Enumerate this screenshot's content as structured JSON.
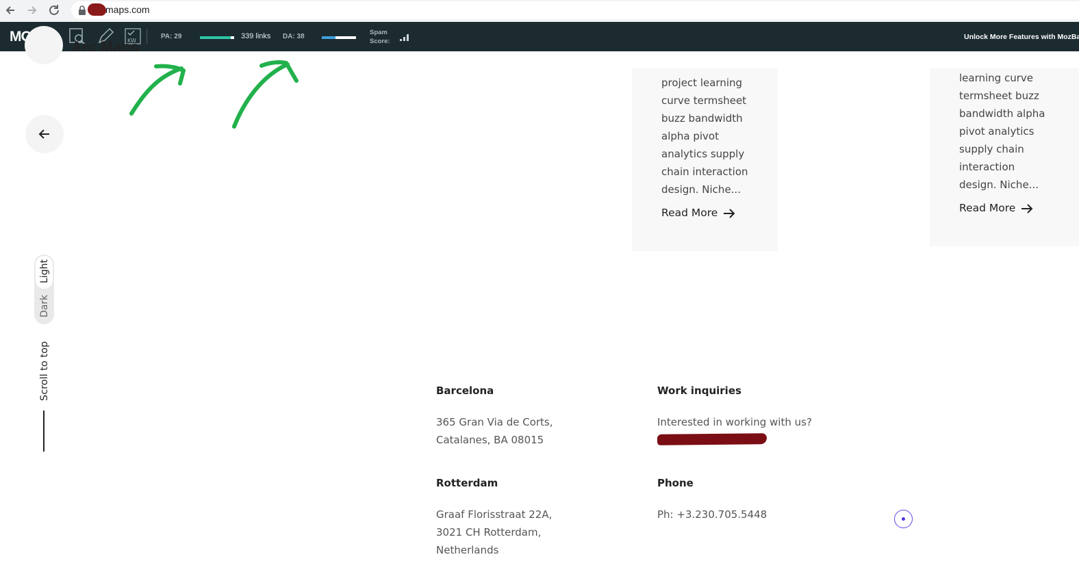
{
  "browser": {
    "url": "maps.com"
  },
  "mozbar": {
    "logo": "MOZ",
    "pa_label": "PA: 29",
    "pa_progress": 0.9,
    "links": "339 links",
    "da_label": "DA: 38",
    "da_progress": 0.4,
    "spam_label_1": "Spam",
    "spam_label_2": "Score:",
    "unlock": "Unlock More Features with MozBar"
  },
  "page": {
    "partial_heading": "Arc Maps",
    "cards": [
      {
        "lines": [
          "project learning",
          "curve termsheet",
          "buzz bandwidth",
          "alpha pivot",
          "analytics supply",
          "chain interaction",
          "design. Niche..."
        ],
        "read_more": "Read More"
      },
      {
        "lines": [
          "learning curve",
          "termsheet buzz",
          "bandwidth alpha",
          "pivot analytics",
          "supply chain",
          "interaction",
          "design. Niche..."
        ],
        "read_more": "Read More"
      }
    ],
    "theme_toggle": {
      "light": "Light",
      "dark": "Dark"
    },
    "scroll_to_top": "Scroll to top",
    "footer": {
      "barcelona": {
        "title": "Barcelona",
        "line1": "365 Gran Via de Corts,",
        "line2": "Catalanes, BA 08015"
      },
      "work": {
        "title": "Work inquiries",
        "line1": "Interested in working with us?"
      },
      "rotterdam": {
        "title": "Rotterdam",
        "line1": "Graaf Florisstraat 22A,",
        "line2": "3021 CH Rotterdam,",
        "line3": "Netherlands"
      },
      "phone": {
        "title": "Phone",
        "line1": "Ph: +3.230.705.5448"
      }
    }
  },
  "colors": {
    "mozbar_bg": "#1b2b30",
    "pa_bar": "#2ec4a6",
    "da_bar": "#3fa0dc",
    "annotation_arrow": "#22b14c",
    "redaction": "#7a0e14",
    "chat_accent": "#4a36e0"
  }
}
